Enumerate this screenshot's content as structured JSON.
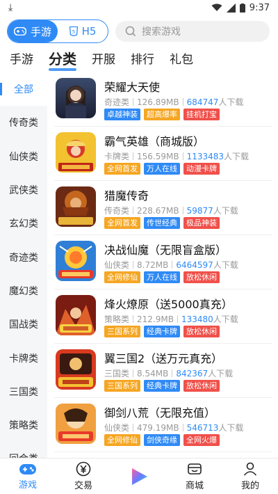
{
  "status": {
    "time": "9:37"
  },
  "toggle": {
    "mobile_label": "手游",
    "h5_label": "H5"
  },
  "search": {
    "placeholder": "搜索游戏"
  },
  "tabs": [
    {
      "label": "手游"
    },
    {
      "label": "分类"
    },
    {
      "label": "开服"
    },
    {
      "label": "排行"
    },
    {
      "label": "礼包"
    }
  ],
  "active_tab": "分类",
  "sidebar": {
    "items": [
      {
        "label": "全部"
      },
      {
        "label": "传奇类"
      },
      {
        "label": "仙侠类"
      },
      {
        "label": "武侠类"
      },
      {
        "label": "玄幻类"
      },
      {
        "label": "奇迹类"
      },
      {
        "label": "魔幻类"
      },
      {
        "label": "国战类"
      },
      {
        "label": "卡牌类"
      },
      {
        "label": "三国类"
      },
      {
        "label": "策略类"
      },
      {
        "label": "回合类"
      }
    ]
  },
  "download_suffix": "人下载",
  "games": [
    {
      "name": "荣耀大天使",
      "category": "奇迹类",
      "size": "126.89MB",
      "downloads": "684747",
      "tags": [
        {
          "text": "卓越神装",
          "color": "#2f8af5"
        },
        {
          "text": "超高爆率",
          "color": "#f5a623"
        },
        {
          "text": "挂机打宝",
          "color": "#f0504a"
        }
      ]
    },
    {
      "name": "霸气英雄（商城版）",
      "category": "卡牌类",
      "size": "156.59MB",
      "downloads": "1133483",
      "tags": [
        {
          "text": "全网首发",
          "color": "#f5a623"
        },
        {
          "text": "万人在线",
          "color": "#2f8af5"
        },
        {
          "text": "动漫卡牌",
          "color": "#f0504a"
        }
      ]
    },
    {
      "name": "猎魔传奇",
      "category": "传奇类",
      "size": "228.67MB",
      "downloads": "59877",
      "tags": [
        {
          "text": "全网首发",
          "color": "#f5a623"
        },
        {
          "text": "传世经典",
          "color": "#2f8af5"
        },
        {
          "text": "极品神装",
          "color": "#f0504a"
        }
      ]
    },
    {
      "name": "决战仙魔（无限盲盒版）",
      "category": "仙侠类",
      "size": "8.72MB",
      "downloads": "6464597",
      "tags": [
        {
          "text": "全网修仙",
          "color": "#f5a623"
        },
        {
          "text": "万人在线",
          "color": "#2f8af5"
        },
        {
          "text": "放松休闲",
          "color": "#f0504a"
        }
      ]
    },
    {
      "name": "烽火燎原（送5000真充）",
      "category": "策略类",
      "size": "212.9MB",
      "downloads": "133480",
      "tags": [
        {
          "text": "三国系列",
          "color": "#f5a623"
        },
        {
          "text": "经典卡牌",
          "color": "#2f8af5"
        },
        {
          "text": "放松休闲",
          "color": "#f0504a"
        }
      ]
    },
    {
      "name": "翼三国2（送万元真充）",
      "category": "三国类",
      "size": "8.54MB",
      "downloads": "842367",
      "tags": [
        {
          "text": "三国系列",
          "color": "#f5a623"
        },
        {
          "text": "经典卡牌",
          "color": "#2f8af5"
        },
        {
          "text": "放松休闲",
          "color": "#f0504a"
        }
      ]
    },
    {
      "name": "御剑八荒（无限充值）",
      "category": "仙侠类",
      "size": "479.19MB",
      "downloads": "546713",
      "tags": [
        {
          "text": "全网修仙",
          "color": "#f5a623"
        },
        {
          "text": "剑侠奇缘",
          "color": "#2f8af5"
        },
        {
          "text": "全网火爆",
          "color": "#f0504a"
        }
      ]
    }
  ],
  "bottom_nav": {
    "games": "游戏",
    "trade": "交易",
    "mall": "商城",
    "mine": "我的"
  },
  "colors": {
    "accent": "#2f8af5",
    "orange": "#f5a623",
    "red": "#f0504a"
  }
}
